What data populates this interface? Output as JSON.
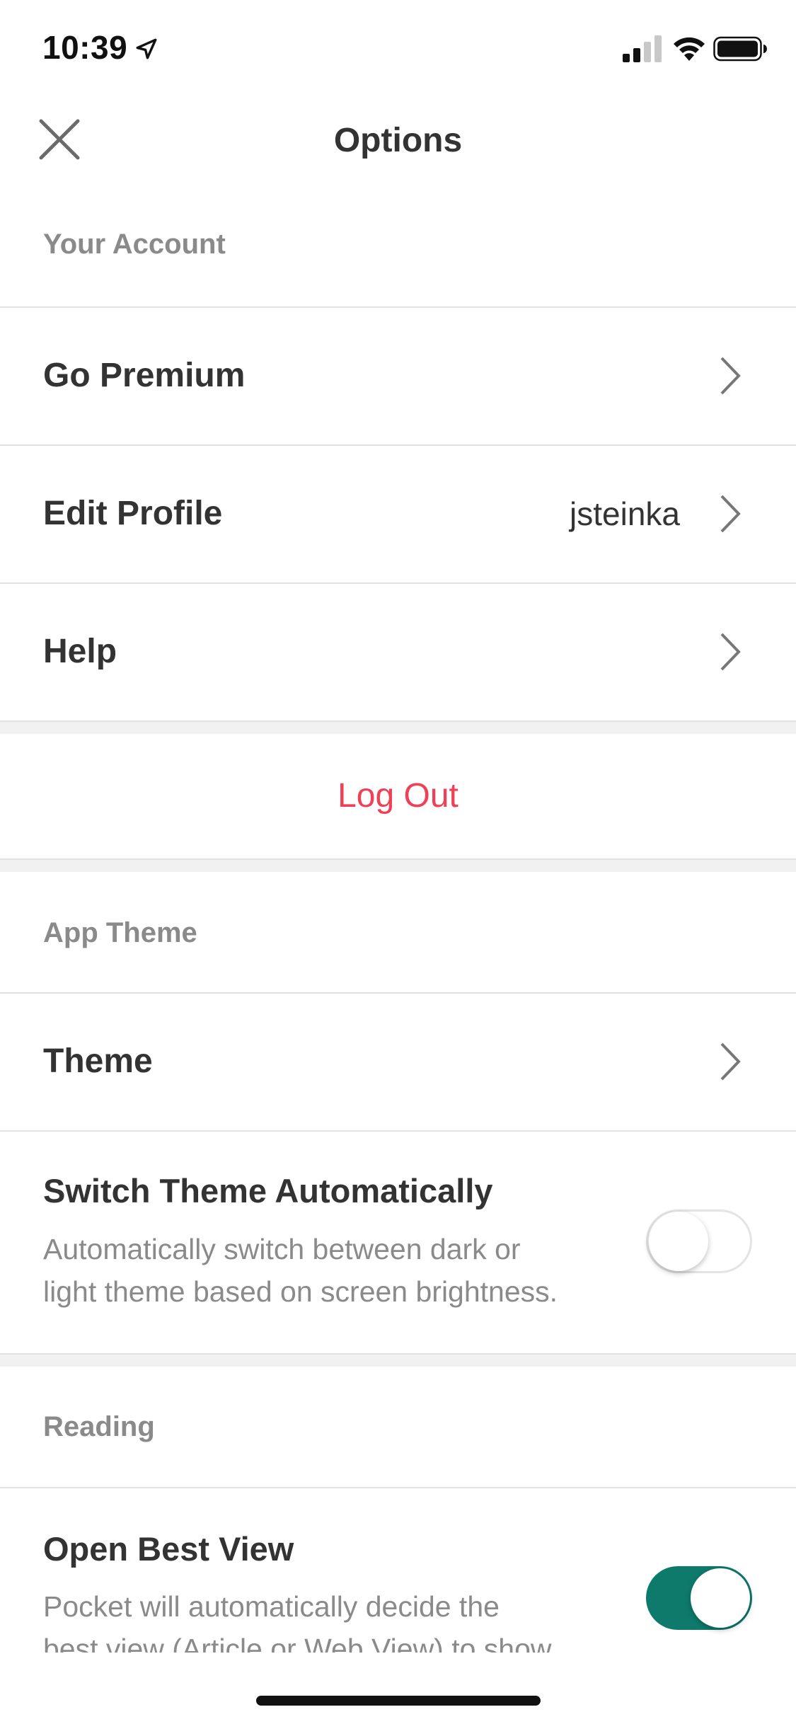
{
  "status_bar": {
    "time": "10:39"
  },
  "nav": {
    "title": "Options",
    "close_icon": "close-icon"
  },
  "sections": {
    "account_header": "Your Account",
    "go_premium": "Go Premium",
    "edit_profile": {
      "label": "Edit Profile",
      "value": "jsteinka"
    },
    "help": "Help",
    "log_out": "Log Out",
    "theme_header": "App Theme",
    "theme": "Theme",
    "switch_theme": {
      "label": "Switch Theme Automatically",
      "description_line1": "Automatically switch between dark or",
      "description_line2": "light theme based on screen brightness.",
      "enabled": false
    },
    "reading_header": "Reading",
    "open_best_view": {
      "label": "Open Best View",
      "description_line1": "Pocket will automatically decide the",
      "description_line2": "best view (Article or Web View) to show",
      "enabled": true
    }
  },
  "colors": {
    "accent": "#0d7a6b",
    "logout": "#ee4056",
    "section_header": "#8a8a8a",
    "divider": "#e2e2e2"
  }
}
